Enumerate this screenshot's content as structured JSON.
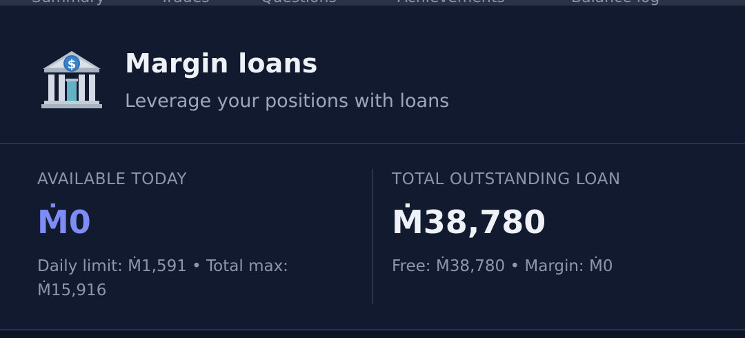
{
  "tabs": [
    {
      "label": "Summary"
    },
    {
      "label": "Trades"
    },
    {
      "label": "Questions"
    },
    {
      "label": "Achievements"
    },
    {
      "label": "Balance log"
    }
  ],
  "header": {
    "icon": "bank-icon",
    "title": "Margin loans",
    "subtitle": "Leverage your positions with loans"
  },
  "available": {
    "label": "AVAILABLE TODAY",
    "value": "Ṁ0",
    "note": "Daily limit: Ṁ1,591 • Total max: Ṁ15,916"
  },
  "outstanding": {
    "label": "TOTAL OUTSTANDING LOAN",
    "value": "Ṁ38,780",
    "note": "Free: Ṁ38,780 • Margin: Ṁ0"
  },
  "colors": {
    "background": "#111a2e",
    "accent": "#7e8cf6",
    "text_primary": "#eef1f7",
    "text_muted": "#8e96ab"
  }
}
